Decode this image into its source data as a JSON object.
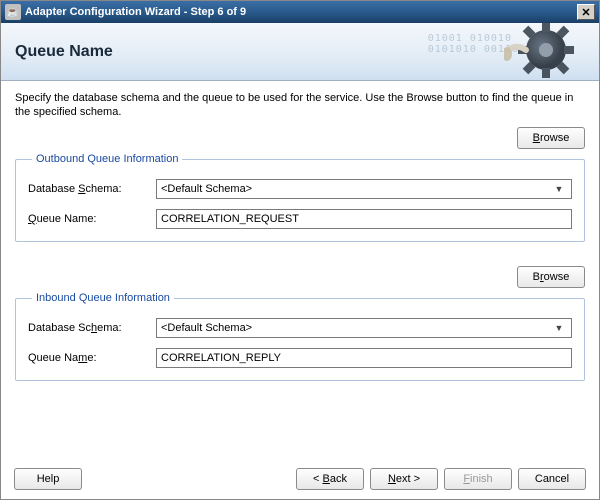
{
  "window": {
    "title": "Adapter Configuration Wizard - Step 6 of 9"
  },
  "banner": {
    "title": "Queue Name"
  },
  "instructions": "Specify the database schema and the queue to be used for the service. Use the Browse button to find the queue in the specified schema.",
  "buttons": {
    "browse": "Browse",
    "help": "Help",
    "back": "< Back",
    "next": "Next >",
    "finish": "Finish",
    "cancel": "Cancel"
  },
  "outbound": {
    "legend": "Outbound Queue Information",
    "db_schema_label_pre": "Database ",
    "db_schema_label_u": "S",
    "db_schema_label_post": "chema:",
    "db_schema_value": "<Default Schema>",
    "queue_label_pre": "",
    "queue_label_u": "Q",
    "queue_label_post": "ueue Name:",
    "queue_value": "CORRELATION_REQUEST"
  },
  "inbound": {
    "legend": "Inbound Queue Information",
    "db_schema_label_pre": "Database Sc",
    "db_schema_label_u": "h",
    "db_schema_label_post": "ema:",
    "db_schema_value": "<Default Schema>",
    "queue_label_pre": "Queue Na",
    "queue_label_u": "m",
    "queue_label_post": "e:",
    "queue_value": "CORRELATION_REPLY"
  }
}
